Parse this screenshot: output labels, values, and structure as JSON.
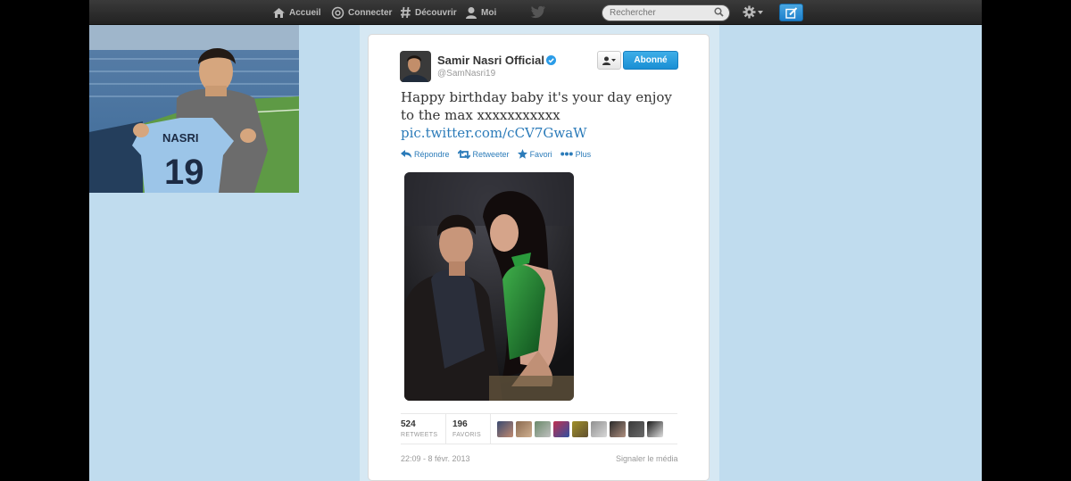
{
  "topbar": {
    "nav": [
      {
        "label": "Accueil",
        "icon": "home-icon"
      },
      {
        "label": "Connecter",
        "icon": "at-icon"
      },
      {
        "label": "Découvrir",
        "icon": "hashtag-icon"
      },
      {
        "label": "Moi",
        "icon": "user-icon"
      }
    ],
    "search_placeholder": "Rechercher"
  },
  "header_photo": {
    "jersey_name": "NASRI",
    "jersey_number": "19"
  },
  "tweet": {
    "display_name": "Samir Nasri Official",
    "handle": "@SamNasri19",
    "follow_label": "Abonné",
    "text": "Happy birthday baby it's your day enjoy to the max xxxxxxxxxxx",
    "link": "pic.twitter.com/cCV7GwaW",
    "actions": [
      {
        "label": "Répondre",
        "icon": "reply-icon"
      },
      {
        "label": "Retweeter",
        "icon": "retweet-icon"
      },
      {
        "label": "Favori",
        "icon": "star-icon"
      },
      {
        "label": "Plus",
        "icon": "more-icon"
      }
    ],
    "stats": {
      "retweets": {
        "value": "524",
        "label": "RETWEETS"
      },
      "favorites": {
        "value": "196",
        "label": "FAVORIS"
      }
    },
    "timestamp": "22:09 - 8 févr. 2013",
    "report_label": "Signaler le média"
  },
  "colors": {
    "page_bg": "#c0dcee",
    "topbar": "#2b2b2b",
    "link": "#2b7bb9",
    "follow_button": "#2a9fe0"
  }
}
